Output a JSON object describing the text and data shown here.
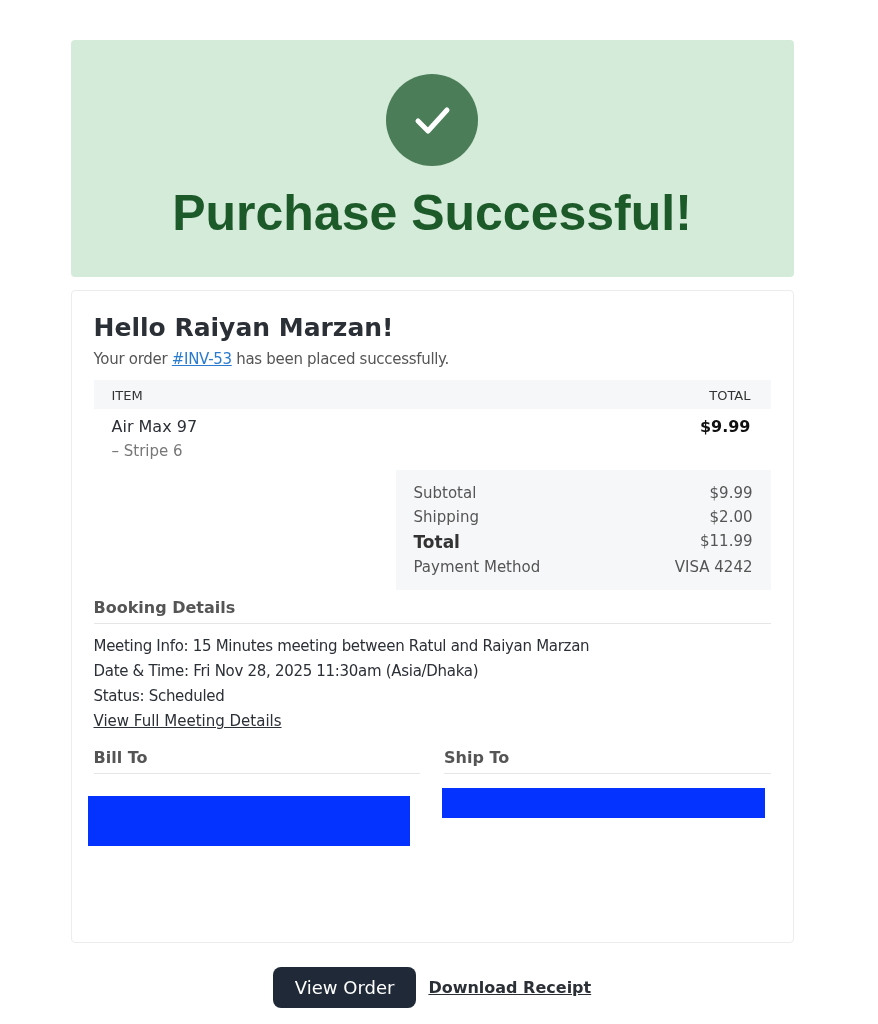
{
  "banner": {
    "title": "Purchase Successful!"
  },
  "greeting": "Hello Raiyan Marzan!",
  "order_message": {
    "before": "Your order",
    "link": "#INV-53",
    "after": "has been placed successfully."
  },
  "items_table": {
    "columns": [
      "ITEM",
      "TOTAL"
    ],
    "rows": [
      {
        "name": "Air Max 97",
        "variant": "– Stripe 6",
        "total": "$9.99"
      }
    ]
  },
  "summary": [
    {
      "label": "Subtotal",
      "value": "$9.99",
      "kind": "normal"
    },
    {
      "label": "Shipping",
      "value": "$2.00",
      "kind": "normal"
    },
    {
      "label": "Total",
      "value": "$11.99",
      "kind": "total"
    },
    {
      "label": "Payment Method",
      "value": "VISA 4242",
      "kind": "normal"
    }
  ],
  "booking": {
    "title": "Booking Details",
    "fields": [
      {
        "label": "Meeting Info:",
        "value": "15 Minutes meeting between Ratul and Raiyan Marzan"
      },
      {
        "label": "Date & Time:",
        "value": "Fri Nov 28, 2025 11:30am (Asia/Dhaka)"
      },
      {
        "label": "Status:",
        "value": "Scheduled"
      }
    ],
    "link": "View Full Meeting Details"
  },
  "addresses": [
    {
      "title": "Bill To",
      "redacted": true
    },
    {
      "title": "Ship To",
      "redacted": true
    }
  ],
  "actions": {
    "primary": "View Order",
    "secondary": "Download Receipt"
  }
}
